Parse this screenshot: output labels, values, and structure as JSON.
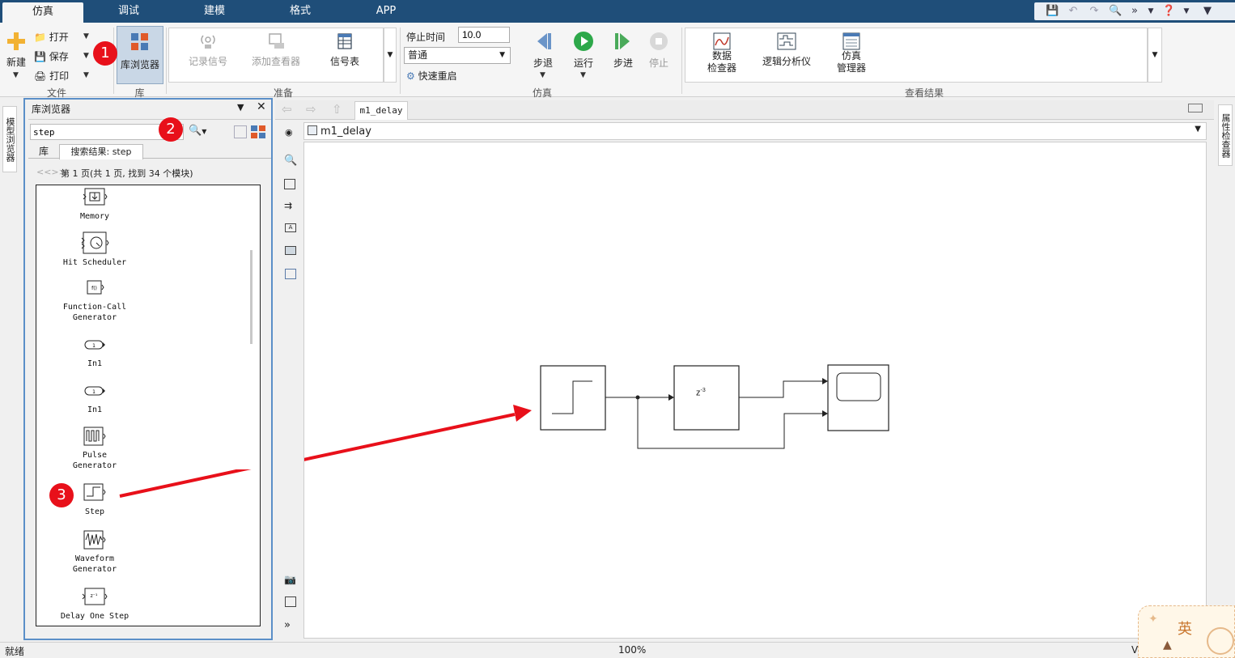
{
  "tabs": [
    {
      "label": "仿真",
      "active": true
    },
    {
      "label": "调试"
    },
    {
      "label": "建模"
    },
    {
      "label": "格式"
    },
    {
      "label": "APP"
    }
  ],
  "ribbon": {
    "file": {
      "new": "新建",
      "open": "打开",
      "save": "保存",
      "print": "打印",
      "group": "文件"
    },
    "library": {
      "browser": "库浏览器",
      "group": "库"
    },
    "prepare": {
      "log_signals": "记录信号",
      "add_viewer": "添加查看器",
      "signal_table": "信号表",
      "group": "准备"
    },
    "simulate": {
      "stop_time_label": "停止时间",
      "stop_time_value": "10.0",
      "mode": "普通",
      "fast_restart": "快速重启",
      "step_back": "步退",
      "run": "运行",
      "step_forward": "步进",
      "stop": "停止",
      "group": "仿真"
    },
    "review": {
      "data_inspector_1": "数据",
      "data_inspector_2": "检查器",
      "logic_analyzer": "逻辑分析仪",
      "sim_manager_1": "仿真",
      "sim_manager_2": "管理器",
      "group": "查看结果"
    }
  },
  "left_strip": {
    "model_browser": "模型浏览器"
  },
  "right_strip": {
    "property_inspector": "属性检查器"
  },
  "library_browser": {
    "title": "库浏览器",
    "search_value": "step",
    "tab_library": "库",
    "tab_results": "搜索结果: step",
    "paging": "第 1 页(共 1 页, 找到 34 个模块)",
    "blocks": [
      {
        "name": "Memory",
        "icon": "memory-icon"
      },
      {
        "name": "Hit Scheduler",
        "icon": "hit-scheduler-icon"
      },
      {
        "name": "Function-Call\nGenerator",
        "name_1": "Function-Call",
        "name_2": "Generator",
        "icon": "function-call-icon"
      },
      {
        "name": "In1",
        "icon": "inport-icon"
      },
      {
        "name": "In1",
        "icon": "inport-icon"
      },
      {
        "name": "Pulse\nGenerator",
        "name_1": "Pulse",
        "name_2": "Generator",
        "icon": "pulse-icon"
      },
      {
        "name": "Step",
        "icon": "step-icon"
      },
      {
        "name": "Waveform\nGenerator",
        "name_1": "Waveform",
        "name_2": "Generator",
        "icon": "waveform-icon"
      },
      {
        "name": "Delay One Step",
        "icon": "delay-icon"
      }
    ]
  },
  "model": {
    "tab": "m1_delay",
    "breadcrumb": "m1_delay",
    "delay_label": "z",
    "delay_exp": "-3"
  },
  "status": {
    "left": "就绪",
    "zoom": "100%",
    "right": "V"
  },
  "annotations": [
    "1",
    "2",
    "3"
  ],
  "watermark": {
    "char": "英"
  },
  "colors": {
    "title_bar": "#1f4e79",
    "selection": "#5b8fc8",
    "annotation": "#e8101a"
  }
}
